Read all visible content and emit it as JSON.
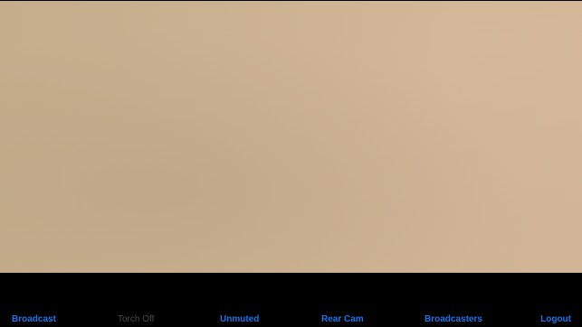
{
  "toolbar": {
    "broadcast": "Broadcast",
    "torch": "Torch Off",
    "mute": "Unmuted",
    "camera": "Rear Cam",
    "broadcasters": "Broadcasters",
    "logout": "Logout"
  },
  "colors": {
    "accent": "#1a74e8",
    "disabled": "#4a4a4a",
    "background": "#000000"
  }
}
